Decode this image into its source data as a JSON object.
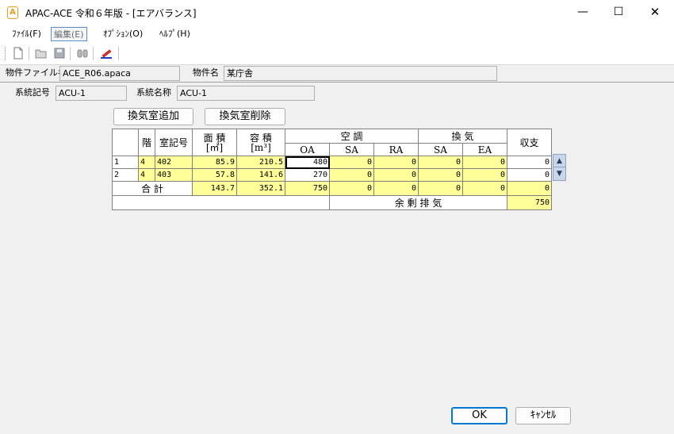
{
  "window": {
    "title": "APAC-ACE 令和６年版 - [エアバランス]",
    "minimize": "—",
    "maximize": "☐",
    "close": "✕"
  },
  "menu": [
    {
      "label": "ﾌｧｲﾙ(F)"
    },
    {
      "label": "編集(E)",
      "selected": true
    },
    {
      "label": "ｵﾌﾟｼｮﾝ(O)"
    },
    {
      "label": "ﾍﾙﾌﾟ(H)"
    }
  ],
  "toolbar": {
    "icons": [
      "new-file-icon",
      "open-folder-icon",
      "save-icon",
      "binoculars-icon",
      "pen-chart-icon"
    ]
  },
  "info": {
    "file_label": "物件ファイル名",
    "file_value": "ACE_R06.apaca",
    "property_label": "物件名",
    "property_value": "某庁舎"
  },
  "system": {
    "code_label": "系統記号",
    "code_value": "ACU-1",
    "name_label": "系統名称",
    "name_value": "ACU-1"
  },
  "buttons": {
    "add_room": "換気室追加",
    "delete_room": "換気室削除",
    "ok": "OK",
    "cancel": "ｷｬﾝｾﾙ"
  },
  "table": {
    "headers": {
      "floor": "階",
      "room": "室記号",
      "area": "面 積",
      "area_unit": "[㎡]",
      "volume": "容 積",
      "volume_unit": "[m³]",
      "ac_group": "空 調",
      "vent_group": "換 気",
      "oa": "OA",
      "sa": "SA",
      "ra": "RA",
      "vsa": "SA",
      "ea": "EA",
      "balance": "収支"
    },
    "rows": [
      {
        "no": "1",
        "floor": "4",
        "room": "402",
        "area": "85.9",
        "volume": "210.5",
        "oa": "480",
        "sa": "0",
        "ra": "0",
        "vsa": "0",
        "ea": "0",
        "balance": "0"
      },
      {
        "no": "2",
        "floor": "4",
        "room": "403",
        "area": "57.8",
        "volume": "141.6",
        "oa": "270",
        "sa": "0",
        "ra": "0",
        "vsa": "0",
        "ea": "0",
        "balance": "0"
      }
    ],
    "total": {
      "label": "合 計",
      "area": "143.7",
      "volume": "352.1",
      "oa": "750",
      "sa": "0",
      "ra": "0",
      "vsa": "0",
      "ea": "0",
      "balance": "0"
    },
    "surplus": {
      "label": "余 剰 排 気",
      "value": "750"
    }
  },
  "colors": {
    "cell_yellow": "#ffff99",
    "accent": "#0078d4"
  }
}
